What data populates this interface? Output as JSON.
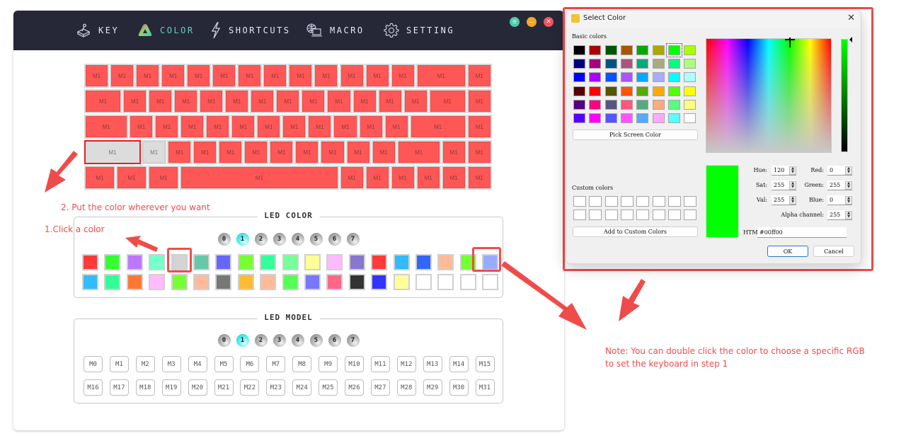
{
  "app": {
    "nav": [
      {
        "label": "KEY",
        "icon": "keycap-joystick-icon",
        "active": false
      },
      {
        "label": "COLOR",
        "icon": "color-triangle-icon",
        "active": true
      },
      {
        "label": "SHORTCUTS",
        "icon": "lightning-icon",
        "active": false
      },
      {
        "label": "MACRO",
        "icon": "globe-laptop-icon",
        "active": false
      },
      {
        "label": "SETTING",
        "icon": "gear-icon",
        "active": false
      }
    ],
    "window_controls": [
      {
        "name": "menu",
        "glyph": "☰",
        "color": "#4fc9a8"
      },
      {
        "name": "minimize",
        "glyph": "—",
        "color": "#f5a623"
      },
      {
        "name": "close",
        "glyph": "✕",
        "color": "#f2545b"
      }
    ],
    "key_color": "#fe5756",
    "key_unset_color": "#dcdcdc",
    "keyboard": {
      "rows": [
        {
          "keys": [
            {
              "label": "M1",
              "w": 1
            },
            {
              "label": "M1",
              "w": 1
            },
            {
              "label": "M1",
              "w": 1
            },
            {
              "label": "M1",
              "w": 1
            },
            {
              "label": "M1",
              "w": 1
            },
            {
              "label": "M1",
              "w": 1
            },
            {
              "label": "M1",
              "w": 1
            },
            {
              "label": "M1",
              "w": 1
            },
            {
              "label": "M1",
              "w": 1
            },
            {
              "label": "M1",
              "w": 1
            },
            {
              "label": "M1",
              "w": 1
            },
            {
              "label": "M1",
              "w": 1
            },
            {
              "label": "M1",
              "w": 1
            },
            {
              "label": "M1",
              "w": 2
            },
            {
              "label": "M1",
              "w": 1
            }
          ]
        },
        {
          "keys": [
            {
              "label": "M1",
              "w": 1.5
            },
            {
              "label": "M1",
              "w": 1
            },
            {
              "label": "M1",
              "w": 1
            },
            {
              "label": "M1",
              "w": 1
            },
            {
              "label": "M1",
              "w": 1
            },
            {
              "label": "M1",
              "w": 1
            },
            {
              "label": "M1",
              "w": 1
            },
            {
              "label": "M1",
              "w": 1
            },
            {
              "label": "M1",
              "w": 1
            },
            {
              "label": "M1",
              "w": 1
            },
            {
              "label": "M1",
              "w": 1
            },
            {
              "label": "M1",
              "w": 1
            },
            {
              "label": "M1",
              "w": 1
            },
            {
              "label": "M1",
              "w": 1.5
            },
            {
              "label": "M1",
              "w": 1
            }
          ]
        },
        {
          "keys": [
            {
              "label": "M1",
              "w": 1.75
            },
            {
              "label": "M1",
              "w": 1
            },
            {
              "label": "M1",
              "w": 1
            },
            {
              "label": "M1",
              "w": 1
            },
            {
              "label": "M1",
              "w": 1
            },
            {
              "label": "M1",
              "w": 1
            },
            {
              "label": "M1",
              "w": 1
            },
            {
              "label": "M1",
              "w": 1
            },
            {
              "label": "M1",
              "w": 1
            },
            {
              "label": "M1",
              "w": 1
            },
            {
              "label": "M1",
              "w": 1
            },
            {
              "label": "M1",
              "w": 1
            },
            {
              "label": "M1",
              "w": 2.25
            },
            {
              "label": "M1",
              "w": 1
            }
          ]
        },
        {
          "keys": [
            {
              "label": "M1",
              "w": 2.25,
              "state": "gray-selected"
            },
            {
              "label": "M1",
              "w": 1,
              "state": "gray"
            },
            {
              "label": "M1",
              "w": 1
            },
            {
              "label": "M1",
              "w": 1
            },
            {
              "label": "M1",
              "w": 1
            },
            {
              "label": "M1",
              "w": 1
            },
            {
              "label": "M1",
              "w": 1
            },
            {
              "label": "M1",
              "w": 1
            },
            {
              "label": "M1",
              "w": 1
            },
            {
              "label": "M1",
              "w": 1
            },
            {
              "label": "M1",
              "w": 1
            },
            {
              "label": "M1",
              "w": 1.75
            },
            {
              "label": "M1",
              "w": 1
            },
            {
              "label": "M1",
              "w": 1
            }
          ]
        },
        {
          "keys": [
            {
              "label": "M1",
              "w": 1.25
            },
            {
              "label": "M1",
              "w": 1.25
            },
            {
              "label": "M1",
              "w": 1.25
            },
            {
              "label": "M1",
              "w": 6.25
            },
            {
              "label": "M1",
              "w": 1
            },
            {
              "label": "M1",
              "w": 1
            },
            {
              "label": "M1",
              "w": 1
            },
            {
              "label": "M1",
              "w": 1
            },
            {
              "label": "M1",
              "w": 1
            },
            {
              "label": "M1",
              "w": 1
            }
          ]
        }
      ]
    },
    "led_color": {
      "title": "LED COLOR",
      "pages": [
        "0",
        "1",
        "2",
        "3",
        "4",
        "5",
        "6",
        "7"
      ],
      "active_page": 1,
      "swatches_row1": [
        "#ff3a3a",
        "#33ff33",
        "#bb77ff",
        "#77ffcc",
        "#d4d4d4",
        "#66c8a8",
        "#6666ff",
        "#77ff33",
        "#33ff99",
        "#77ff99",
        "#ffff99",
        "#ffbbff",
        "#8877cc",
        "#ff3a3a",
        "#33bbff",
        "#3366ff",
        "#ffbb99",
        "#77ff33",
        "#99aaff"
      ],
      "swatches_row2": [
        "#33bbff",
        "#33ff99",
        "#ff7733",
        "#ffbbff",
        "#77ff33",
        "#ffbb99",
        "#777777",
        "#ffbb33",
        "#ffbb99",
        "#55ff55",
        "#7777ff",
        "#ff6688",
        "#333333",
        "#3333ff",
        "#ffff99",
        "#ffffff",
        "#ffffff",
        "#ffffff",
        "#ffffff"
      ],
      "selected_index_row1": 4,
      "highlighted_index_row1": 18
    },
    "led_model": {
      "title": "LED MODEL",
      "pages": [
        "0",
        "1",
        "2",
        "3",
        "4",
        "5",
        "6",
        "7"
      ],
      "active_page": 1,
      "modes_row1": [
        "M0",
        "M1",
        "M2",
        "M3",
        "M4",
        "M5",
        "M6",
        "M7",
        "M8",
        "M9",
        "M10",
        "M11",
        "M12",
        "M13",
        "M14",
        "M15"
      ],
      "modes_row2": [
        "M16",
        "M17",
        "M18",
        "M19",
        "M20",
        "M21",
        "M22",
        "M23",
        "M24",
        "M25",
        "M26",
        "M27",
        "M28",
        "M29",
        "M30",
        "M31"
      ]
    }
  },
  "annotations": {
    "step2": "2. Put the color wherever you want",
    "step1": "1.Click a color",
    "note": "Note: You can double click the color to choose a specific RGB to set the keyboard in step 1"
  },
  "dialog": {
    "title": "Select Color",
    "close_glyph": "✕",
    "basic_colors_label": "Basic colors",
    "basic_colors": [
      [
        "#000000",
        "#aa0000",
        "#005500",
        "#aa5500",
        "#00aa00",
        "#aaaa00",
        "#00ff00",
        "#aaff00"
      ],
      [
        "#00007f",
        "#aa007f",
        "#00557f",
        "#aa557f",
        "#00aa7f",
        "#aaaa7f",
        "#00ff7f",
        "#aaff7f"
      ],
      [
        "#0000ff",
        "#aa00ff",
        "#0055ff",
        "#aa55ff",
        "#00aaff",
        "#aaaaff",
        "#00ffff",
        "#aaffff"
      ],
      [
        "#550000",
        "#ff0000",
        "#555500",
        "#ff5500",
        "#55aa00",
        "#ffaa00",
        "#55ff00",
        "#ffff00"
      ],
      [
        "#55007f",
        "#ff007f",
        "#55557f",
        "#ff557f",
        "#55aa7f",
        "#ffaa7f",
        "#55ff7f",
        "#ffff7f"
      ],
      [
        "#5500ff",
        "#ff00ff",
        "#5555ff",
        "#ff55ff",
        "#55aaff",
        "#ffaaff",
        "#55ffff",
        "#ffffff"
      ]
    ],
    "selected_basic": [
      0,
      6
    ],
    "pick_screen_label": "Pick Screen Color",
    "custom_colors_label": "Custom colors",
    "add_custom_label": "Add to Custom Colors",
    "current_color": "#00ff00",
    "fields": {
      "hue": {
        "label": "Hue:",
        "value": "120"
      },
      "sat": {
        "label": "Sat:",
        "value": "255"
      },
      "val": {
        "label": "Val:",
        "value": "255"
      },
      "red": {
        "label": "Red:",
        "value": "0"
      },
      "green": {
        "label": "Green:",
        "value": "255"
      },
      "blue": {
        "label": "Blue:",
        "value": "0"
      },
      "alpha": {
        "label": "Alpha channel:",
        "value": "255"
      }
    },
    "html_label": "HTML:",
    "html_value": "#00ff00",
    "ok_label": "OK",
    "cancel_label": "Cancel"
  }
}
